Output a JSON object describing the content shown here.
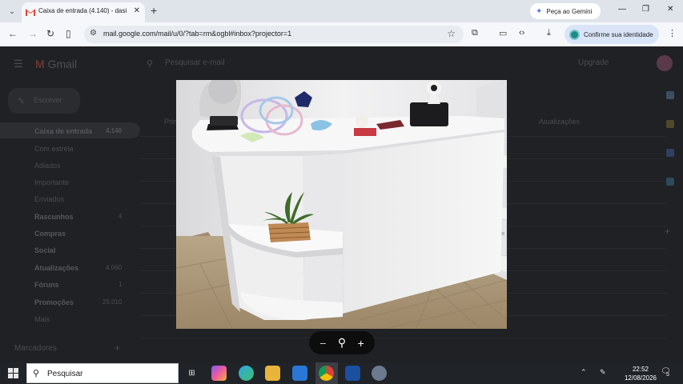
{
  "browser": {
    "tab_title": "Caixa de entrada (4.140) - dasil",
    "gemini_label": "Peça ao Gemini",
    "url": "mail.google.com/mail/u/0/?tab=rm&ogbl#inbox?projector=1",
    "identity_label": "Confirme sua identidade"
  },
  "gmail": {
    "logo": "Gmail",
    "search_placeholder": "Pesquisar e-mail",
    "compose": "Escrever",
    "sidebar": [
      {
        "label": "Caixa de entrada",
        "count": "4.140"
      },
      {
        "label": "Com estrela",
        "count": ""
      },
      {
        "label": "Adiados",
        "count": ""
      },
      {
        "label": "Importante",
        "count": ""
      },
      {
        "label": "Enviados",
        "count": ""
      },
      {
        "label": "Rascunhos",
        "count": "4"
      },
      {
        "label": "Compras",
        "count": ""
      },
      {
        "label": "Social",
        "count": ""
      },
      {
        "label": "Atualizações",
        "count": "4.060"
      },
      {
        "label": "Fóruns",
        "count": "1"
      },
      {
        "label": "Promoções",
        "count": "25.010"
      },
      {
        "label": "Mais",
        "count": ""
      }
    ],
    "labels_heading": "Marcadores",
    "tab_primary": "Principal",
    "tab_updates": "Atualizações",
    "upgrade": "Upgrade"
  },
  "viewer": {
    "zoom_out": "−",
    "zoom_reset": "⚲",
    "zoom_in": "+"
  },
  "taskbar": {
    "search_label": "Pesquisar",
    "time": "22:52",
    "date": "12/08/2026",
    "notifications": "5"
  }
}
